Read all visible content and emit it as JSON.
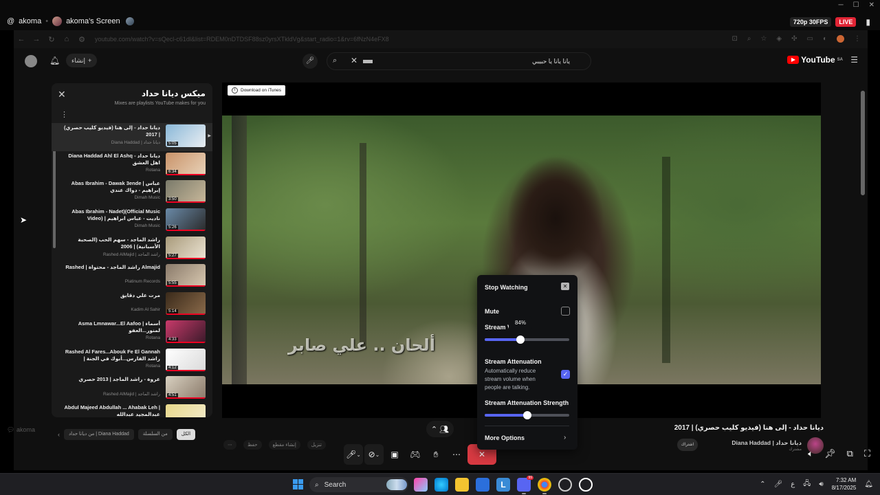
{
  "stream": {
    "user": "akoma",
    "screen_title": "akoma's Screen",
    "quality": "720p 30FPS",
    "live": "LIVE"
  },
  "browser": {
    "url": "youtube.com/watch?v=sQecl-c61dl&list=RDEM0nDTDSF88sz0yrsXTkldVg&start_radio=1&rv=6fNzN4eFX8"
  },
  "youtube": {
    "logo": "YouTube",
    "region": "SA",
    "create_label": "إنشاء",
    "search_value": "يانا يانا يا حبيبي",
    "video_title": "ديانا حداد - إلى هنا (فيديو كليب حصري) | 2017",
    "channel_name": "Diana Haddad | ديانا حداد",
    "channel_subs": "مشترك",
    "subscribe_label": "اشتراك",
    "itunes_label": "Download on iTunes",
    "video_caption": "ألحان .. علي صابر",
    "chips": [
      "الكل",
      "من السلسلة",
      "من ديانا حداد | Diana Haddad"
    ],
    "actions": [
      "حفظ",
      "إنشاء مقطع",
      "تنزيل"
    ]
  },
  "playlist": {
    "title": "ميكس ديانا حداد",
    "subtitle": "Mixes are playlists YouTube makes for you",
    "items": [
      {
        "title": "ديانا حداد - إلى هنا (فيديو كليب حصري) | 2017",
        "channel": "Diana Haddad | ديانا حداد",
        "duration": "5:05",
        "colors": [
          "#8ab8d8",
          "#eaeef2"
        ]
      },
      {
        "title": "Diana Haddad Ahl El Ashq ديانا حداد - اهل العشق",
        "channel": "Rotana",
        "duration": "6:34",
        "colors": [
          "#c9936a",
          "#e8d2b8"
        ]
      },
      {
        "title": "Abas Ibrahim - Dawak 3ende | عباس إبراهيم - دواك عندي",
        "channel": "Dimah Music",
        "duration": "3:50",
        "colors": [
          "#7a7a6a",
          "#c8b89a"
        ]
      },
      {
        "title": "Abas Ibrahim - Nadet)(Official Music Video) | ناديت - عباس ابراهيم",
        "channel": "Dimah Music",
        "duration": "5:26",
        "colors": [
          "#6a8aa8",
          "#2a2a2a"
        ]
      },
      {
        "title": "راشد الماجد - سهم الحب (الصحبة الأسبانية) | 2006",
        "channel": "Rashed AlMajid | راشد الماجد",
        "duration": "5:27",
        "colors": [
          "#a89a7a",
          "#ece4d4"
        ]
      },
      {
        "title": "Rashed | راشد الماجد - محتواة Almajid",
        "channel": "Platinum Records",
        "duration": "5:55",
        "colors": [
          "#8a7a6a",
          "#d8c8b0"
        ]
      },
      {
        "title": "مرت علي دقايق",
        "channel": "Kadim Al Sahir",
        "duration": "5:14",
        "colors": [
          "#3a2a1a",
          "#8a6a4a"
        ]
      },
      {
        "title": "Asma Lmnawar...El Aafoo | أسماء لمنور...العفو",
        "channel": "Rotana",
        "duration": "4:33",
        "colors": [
          "#c83a6a",
          "#3a1a2a"
        ]
      },
      {
        "title": "Rashed Al Fares...Abouk Fe El Gannah | راشد الفارس...أبوك في الجنة",
        "channel": "Rotana",
        "duration": "4:12",
        "colors": [
          "#ffffff",
          "#dadada"
        ]
      },
      {
        "title": "عروة - راشد الماجد | 2013 حصري",
        "channel": "Rashed AlMajid | راشد الماجد",
        "duration": "4:51",
        "colors": [
          "#d8d0c0",
          "#8a7a6a"
        ]
      },
      {
        "title": "Abdul Majeed Abdullah ... Ahabak Leh | عبدالمجيد عبدالله",
        "channel": "",
        "duration": "5:23",
        "colors": [
          "#e8d88a",
          "#f4ecd0"
        ]
      }
    ]
  },
  "popup": {
    "stop_watching": "Stop Watching",
    "mute": "Mute",
    "mute_checked": false,
    "stream_volume": "Stream Volume",
    "volume_tooltip": "84%",
    "volume_fraction": 0.42,
    "attenuation": "Stream Attenuation",
    "attenuation_desc": "Automatically reduce stream volume when people are talking.",
    "attenuation_checked": true,
    "attenuation_strength": "Stream Attenuation Strength",
    "strength_fraction": 0.5,
    "more_options": "More Options"
  },
  "discord_watermark": "akoma",
  "taskbar": {
    "search": "Search",
    "time": "7:32 AM",
    "date": "8/17/2025",
    "lang": "ع",
    "discord_badge": "99"
  },
  "colors": {
    "accent": "#5865f2",
    "live": "#e02434",
    "hangup": "#d83a42"
  }
}
